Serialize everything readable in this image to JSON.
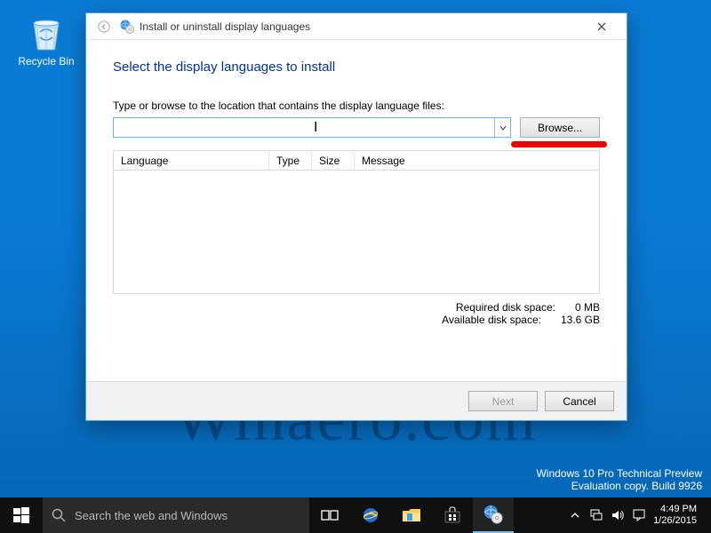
{
  "desktop": {
    "recycle_bin_label": "Recycle Bin",
    "watermark": "Winaero.com",
    "build_line1": "Windows 10 Pro Technical Preview",
    "build_line2": "Evaluation copy. Build 9926"
  },
  "dialog": {
    "title": "Install or uninstall display languages",
    "heading": "Select the display languages to install",
    "instruction": "Type or browse to the location that contains the display language files:",
    "path_value": "",
    "browse_label": "Browse...",
    "columns": {
      "language": "Language",
      "type": "Type",
      "size": "Size",
      "message": "Message"
    },
    "required_label": "Required disk space:",
    "required_value": "0 MB",
    "available_label": "Available disk space:",
    "available_value": "13.6 GB",
    "next_label": "Next",
    "cancel_label": "Cancel"
  },
  "taskbar": {
    "search_placeholder": "Search the web and Windows",
    "time": "4:49 PM",
    "date": "1/26/2015"
  }
}
